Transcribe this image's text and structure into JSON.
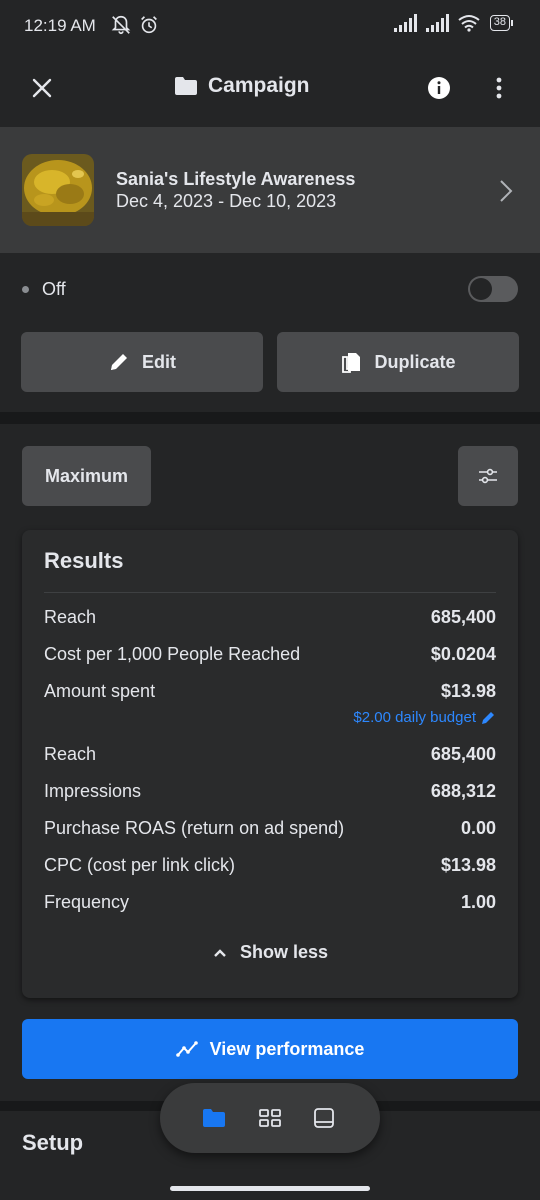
{
  "status_bar": {
    "time": "12:19 AM",
    "battery": "38"
  },
  "header": {
    "title": "Campaign",
    "folder_icon": "folder-icon",
    "close_icon": "close-icon",
    "info_icon": "info-icon",
    "more_icon": "more-vertical-icon"
  },
  "campaign": {
    "name": "Sania's Lifestyle Awareness",
    "dates": "Dec 4, 2023 - Dec 10, 2023"
  },
  "status": {
    "label": "Off",
    "toggle_on": false
  },
  "actions": {
    "edit_label": "Edit",
    "duplicate_label": "Duplicate"
  },
  "filter": {
    "date_range_label": "Maximum"
  },
  "results": {
    "title": "Results",
    "metrics": [
      {
        "label": "Reach",
        "value": "685,400"
      },
      {
        "label": "Cost per 1,000 People Reached",
        "value": "$0.0204"
      },
      {
        "label": "Amount spent",
        "value": "$13.98"
      },
      {
        "label": "Reach",
        "value": "685,400"
      },
      {
        "label": "Impressions",
        "value": "688,312"
      },
      {
        "label": "Purchase ROAS (return on ad spend)",
        "value": "0.00"
      },
      {
        "label": "CPC (cost per link click)",
        "value": "$13.98"
      },
      {
        "label": "Frequency",
        "value": "1.00"
      }
    ],
    "budget_text": "$2.00 daily budget",
    "show_less_label": "Show less"
  },
  "view_performance_label": "View performance",
  "setup_title": "Setup",
  "colors": {
    "accent": "#1877f2",
    "link": "#2d88ff",
    "background": "#242526"
  }
}
